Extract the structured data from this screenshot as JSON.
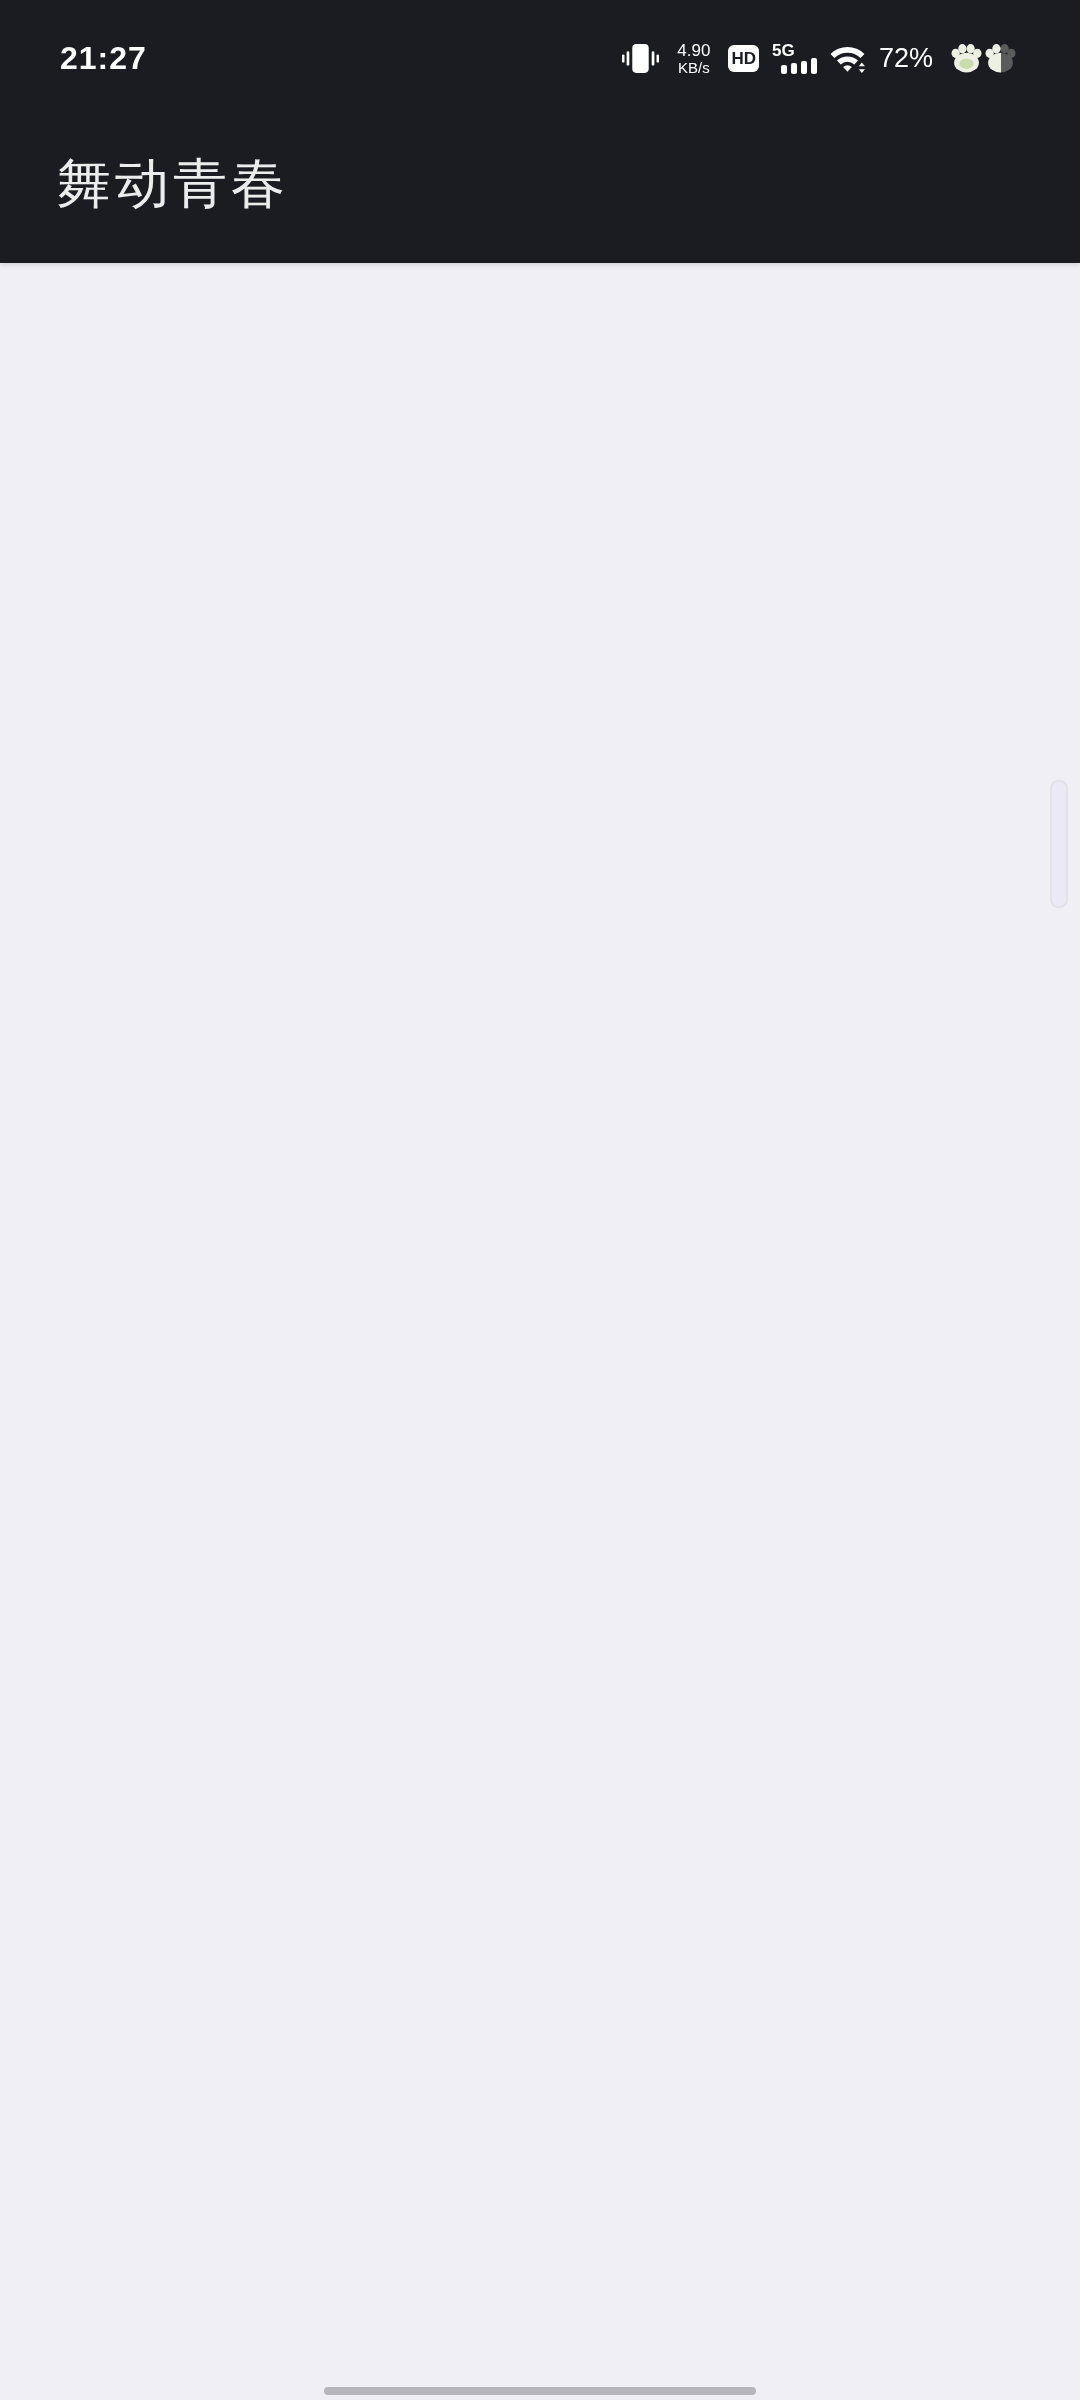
{
  "status_bar": {
    "time": "21:27",
    "net_speed": {
      "value": "4.90",
      "unit": "KB/s"
    },
    "hd_label": "HD",
    "network_type": "5G",
    "battery": "72%"
  },
  "app_bar": {
    "title": "舞动青春"
  }
}
